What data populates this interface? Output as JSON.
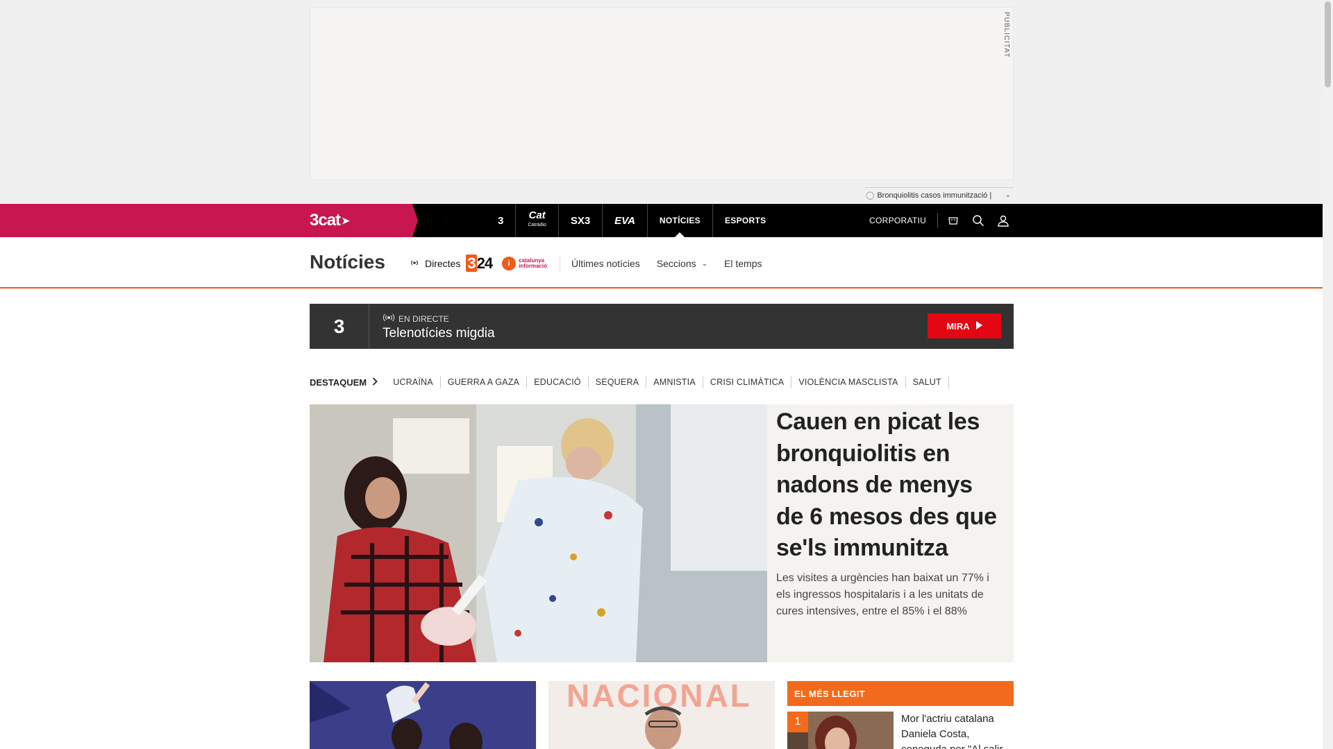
{
  "ad": {
    "label": "PUBLICITAT",
    "tag_text": "Bronquiolitis casos immunització |"
  },
  "topbar": {
    "brand": "3cat",
    "channels": [
      {
        "label": "3",
        "kind": "logo"
      },
      {
        "label": "Cat",
        "sub": "Catràdio",
        "kind": "logo"
      },
      {
        "label": "SX3",
        "kind": "logo"
      },
      {
        "label": "EVA",
        "kind": "logo"
      },
      {
        "label": "NOTÍCIES",
        "kind": "text"
      },
      {
        "label": "ESPORTS",
        "kind": "text"
      }
    ],
    "corporate": "CORPORATIU",
    "icons": [
      "cart-icon",
      "search-icon",
      "user-icon"
    ]
  },
  "secnav": {
    "title": "Notícies",
    "directes": "Directes",
    "logo324_num": "3",
    "logo324_rest": "24",
    "ci_line1": "catalunya",
    "ci_line2": "informació",
    "links": [
      "Últimes notícies",
      "Seccions",
      "El temps"
    ]
  },
  "live": {
    "channel": "3",
    "tag": "EN DIRECTE",
    "title": "Telenotícies migdia",
    "button": "MIRA"
  },
  "destaquem": {
    "lead": "DESTAQUEM",
    "topics": [
      "UCRAÏNA",
      "GUERRA A GAZA",
      "EDUCACIÓ",
      "SEQUERA",
      "AMNISTIA",
      "CRISI CLIMÀTICA",
      "VIOLÈNCIA MASCLISTA",
      "SALUT"
    ]
  },
  "hero": {
    "title": "Cauen en picat les bronquiolitis en nadons de menys de 6 mesos des que se'ls immunitza",
    "subtitle": "Les visites a urgències han baixat un 77% i els ingressos hospitalaris i a les unitats de cures intensives, entre el 85% i el 88%"
  },
  "cards": {
    "card2_banner": "NACIONAL"
  },
  "most_read": {
    "heading": "EL MÉS LLEGIT",
    "items": [
      {
        "rank": "1",
        "title": "Mor l'actriu catalana Daniela Costa, coneguda per \"Al salir"
      }
    ]
  },
  "colors": {
    "brand_pink": "#c8164f",
    "accent_orange": "#f26a1b",
    "live_red": "#e30613"
  }
}
